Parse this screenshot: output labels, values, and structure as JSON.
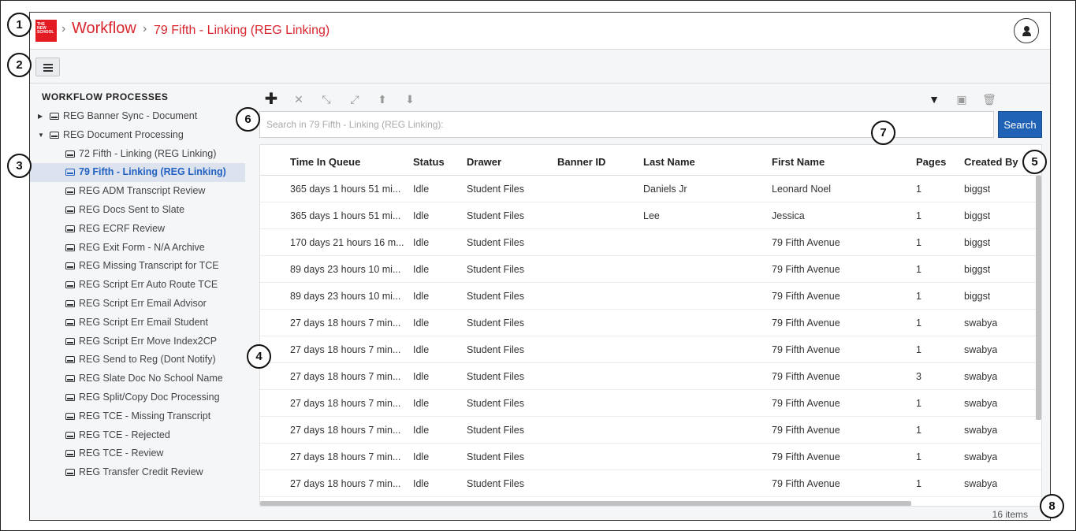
{
  "header": {
    "logo_text": "THE NEW SCHOOL",
    "breadcrumb_sep": "›",
    "breadcrumb_main": "Workflow",
    "breadcrumb_sub": "79 Fifth - Linking (REG Linking)"
  },
  "sidebar": {
    "title": "WORKFLOW PROCESSES",
    "items": [
      {
        "label": "REG Banner Sync - Document",
        "level": 0,
        "expander": "▶"
      },
      {
        "label": "REG Document Processing",
        "level": 0,
        "expander": "▼"
      },
      {
        "label": "72 Fifth - Linking (REG Linking)",
        "level": 1
      },
      {
        "label": "79 Fifth - Linking (REG Linking)",
        "level": 1,
        "selected": true
      },
      {
        "label": "REG ADM Transcript Review",
        "level": 1
      },
      {
        "label": "REG Docs Sent to Slate",
        "level": 1
      },
      {
        "label": "REG ECRF Review",
        "level": 1
      },
      {
        "label": "REG Exit Form - N/A Archive",
        "level": 1
      },
      {
        "label": "REG Missing Transcript for TCE",
        "level": 1
      },
      {
        "label": "REG Script Err Auto Route TCE",
        "level": 1
      },
      {
        "label": "REG Script Err Email Advisor",
        "level": 1
      },
      {
        "label": "REG Script Err Email Student",
        "level": 1
      },
      {
        "label": "REG Script Err Move Index2CP",
        "level": 1
      },
      {
        "label": "REG Send to Reg (Dont Notify)",
        "level": 1
      },
      {
        "label": "REG Slate Doc No School Name",
        "level": 1
      },
      {
        "label": "REG Split/Copy Doc Processing",
        "level": 1
      },
      {
        "label": "REG TCE - Missing Transcript",
        "level": 1
      },
      {
        "label": "REG TCE - Rejected",
        "level": 1
      },
      {
        "label": "REG TCE - Review",
        "level": 1
      },
      {
        "label": "REG Transfer Credit Review",
        "level": 1
      }
    ]
  },
  "toolbar": {
    "icons": {
      "add": "✚",
      "remove": "✕",
      "collapse": "⤡",
      "expand": "⤢",
      "up": "⬆",
      "down": "⬇",
      "filter": "▼",
      "save": "▣",
      "delete": "🗑"
    }
  },
  "search": {
    "placeholder": "Search in 79 Fifth - Linking (REG Linking):",
    "value": "",
    "button_label": "Search"
  },
  "grid": {
    "columns": [
      "Time In Queue",
      "Status",
      "Drawer",
      "Banner ID",
      "Last Name",
      "First Name",
      "Pages",
      "Created By"
    ],
    "rows": [
      [
        "365 days 1 hours 51 mi...",
        "Idle",
        "Student Files",
        "",
        "Daniels Jr",
        "Leonard Noel",
        "1",
        "biggst"
      ],
      [
        "365 days 1 hours 51 mi...",
        "Idle",
        "Student Files",
        "",
        "Lee",
        "Jessica",
        "1",
        "biggst"
      ],
      [
        "170 days 21 hours 16 m...",
        "Idle",
        "Student Files",
        "",
        "",
        "79 Fifth Avenue",
        "1",
        "biggst"
      ],
      [
        "89 days 23 hours 10 mi...",
        "Idle",
        "Student Files",
        "",
        "",
        "79 Fifth Avenue",
        "1",
        "biggst"
      ],
      [
        "89 days 23 hours 10 mi...",
        "Idle",
        "Student Files",
        "",
        "",
        "79 Fifth Avenue",
        "1",
        "biggst"
      ],
      [
        "27 days 18 hours 7 min...",
        "Idle",
        "Student Files",
        "",
        "",
        "79 Fifth Avenue",
        "1",
        "swabya"
      ],
      [
        "27 days 18 hours 7 min...",
        "Idle",
        "Student Files",
        "",
        "",
        "79 Fifth Avenue",
        "1",
        "swabya"
      ],
      [
        "27 days 18 hours 7 min...",
        "Idle",
        "Student Files",
        "",
        "",
        "79 Fifth Avenue",
        "3",
        "swabya"
      ],
      [
        "27 days 18 hours 7 min...",
        "Idle",
        "Student Files",
        "",
        "",
        "79 Fifth Avenue",
        "1",
        "swabya"
      ],
      [
        "27 days 18 hours 7 min...",
        "Idle",
        "Student Files",
        "",
        "",
        "79 Fifth Avenue",
        "1",
        "swabya"
      ],
      [
        "27 days 18 hours 7 min...",
        "Idle",
        "Student Files",
        "",
        "",
        "79 Fifth Avenue",
        "1",
        "swabya"
      ],
      [
        "27 days 18 hours 7 min...",
        "Idle",
        "Student Files",
        "",
        "",
        "79 Fifth Avenue",
        "1",
        "swabya"
      ]
    ],
    "items_count": "16 items"
  },
  "callouts": [
    "1",
    "2",
    "3",
    "4",
    "5",
    "6",
    "7",
    "8"
  ],
  "colors": {
    "brand_red": "#d9262f",
    "accent_blue": "#2062b5",
    "selected_text": "#2161c2"
  }
}
